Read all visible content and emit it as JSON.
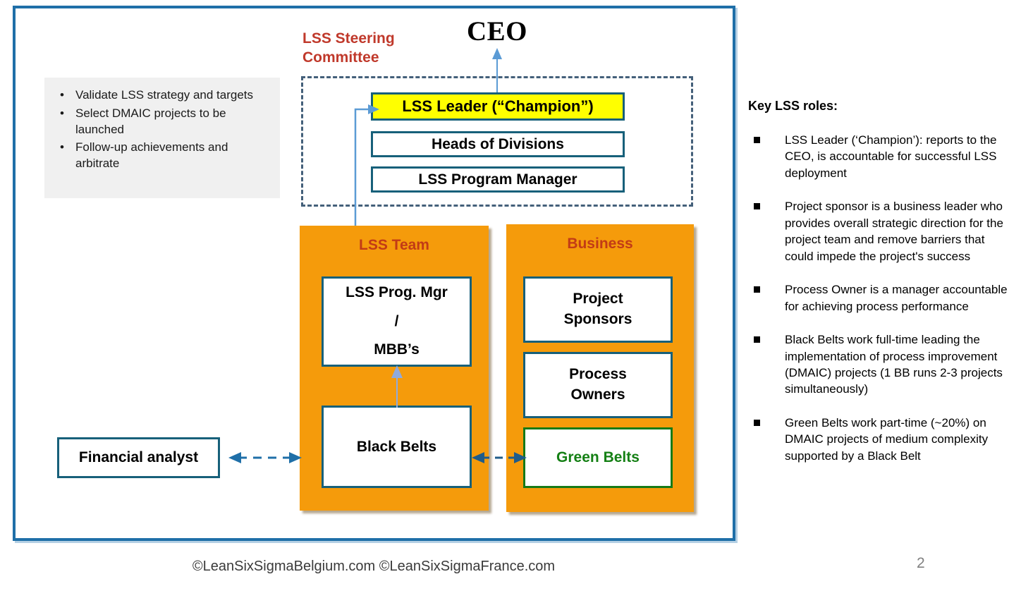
{
  "slide": {
    "ceo_label": "CEO",
    "steering_committee_title": "LSS Steering\nCommittee",
    "steering_boxes": [
      {
        "label": "LSS Leader (“Champion”)"
      },
      {
        "label": "Heads of Divisions"
      },
      {
        "label": "LSS Program Manager"
      }
    ],
    "left_notes": [
      "Validate LSS strategy and targets",
      "Select DMAIC projects to be launched",
      "Follow-up achievements and arbitrate"
    ],
    "lss_team_panel": {
      "title": "LSS Team",
      "prog_mgr_line1": "LSS Prog. Mgr",
      "prog_mgr_line2": "/",
      "prog_mgr_line3": "MBB’s",
      "black_belts": "Black Belts"
    },
    "business_panel": {
      "title": "Business",
      "project_sponsors_line1": "Project",
      "project_sponsors_line2": "Sponsors",
      "process_owners_line1": "Process",
      "process_owners_line2": "Owners",
      "green_belts": "Green Belts"
    },
    "financial_analyst": "Financial analyst",
    "key_roles": {
      "title": "Key LSS roles:",
      "items": [
        "LSS Leader (‘Champion’): reports to the CEO, is accountable for successful LSS deployment",
        "Project sponsor is a business leader who provides overall strategic direction for the project team and remove barriers that could impede the project's success",
        "Process Owner is a manager accountable for achieving process performance",
        "Black Belts work full-time leading the implementation of process improvement (DMAIC) projects (1 BB runs 2-3 projects simultaneously)",
        "Green Belts work part-time (~20%) on DMAIC projects of medium complexity supported by a Black Belt"
      ]
    },
    "footer_copyright": "©LeanSixSigmaBelgium.com ©LeanSixSigmaFrance.com",
    "page_number": "2",
    "bullet_glyph": "•"
  },
  "colors": {
    "frame_blue": "#1F6FA8",
    "steering_red": "#C0392B",
    "panel_orange": "#F59B0B",
    "panel_title_red": "#C23B16",
    "highlight_yellow": "#FFFF00",
    "box_border_teal": "#17607A",
    "green_belt_green": "#158015",
    "connector_light_blue": "#5B9BD5",
    "connector_dark_blue": "#1F6FA8",
    "note_background": "#F0F0F0",
    "page_number_gray": "#808080"
  }
}
